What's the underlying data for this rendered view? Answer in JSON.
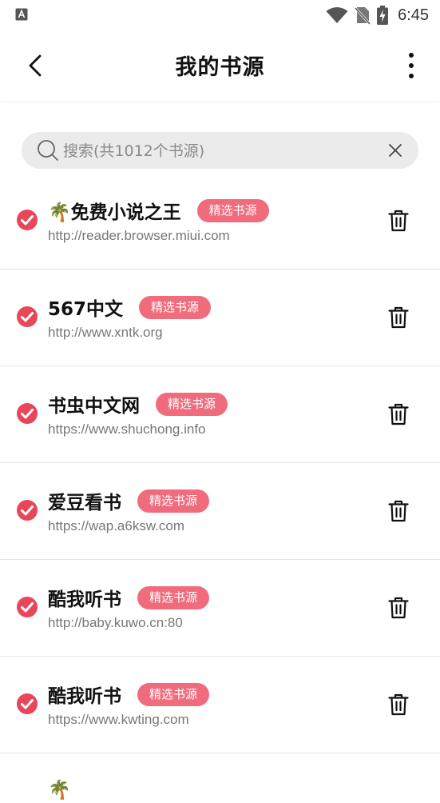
{
  "status_bar": {
    "time": "6:45",
    "icons": [
      "app-a-icon",
      "wifi-icon",
      "no-sim-icon",
      "battery-charging-icon"
    ]
  },
  "header": {
    "title": "我的书源",
    "back_icon": "chevron-left-icon",
    "more_icon": "more-vertical-icon"
  },
  "search": {
    "placeholder": "搜索(共1012个书源)",
    "value": ""
  },
  "colors": {
    "accent": "#e8475a",
    "tag_bg": "#f06c7c",
    "search_bg": "#ebebeb"
  },
  "sources": [
    {
      "name": "🌴免费小说之王",
      "tag": "精选书源",
      "url": "http://reader.browser.miui.com",
      "checked": true
    },
    {
      "name": "567中文",
      "tag": "精选书源",
      "url": "http://www.xntk.org",
      "checked": true
    },
    {
      "name": "书虫中文网",
      "tag": "精选书源",
      "url": "https://www.shuchong.info",
      "checked": true
    },
    {
      "name": "爱豆看书",
      "tag": "精选书源",
      "url": "https://wap.a6ksw.com",
      "checked": true
    },
    {
      "name": "酷我听书",
      "tag": "精选书源",
      "url": "http://baby.kuwo.cn:80",
      "checked": true
    },
    {
      "name": "酷我听书",
      "tag": "精选书源",
      "url": "https://www.kwting.com",
      "checked": true
    },
    {
      "name": "🌴",
      "tag": "",
      "url": "",
      "checked": true
    }
  ]
}
